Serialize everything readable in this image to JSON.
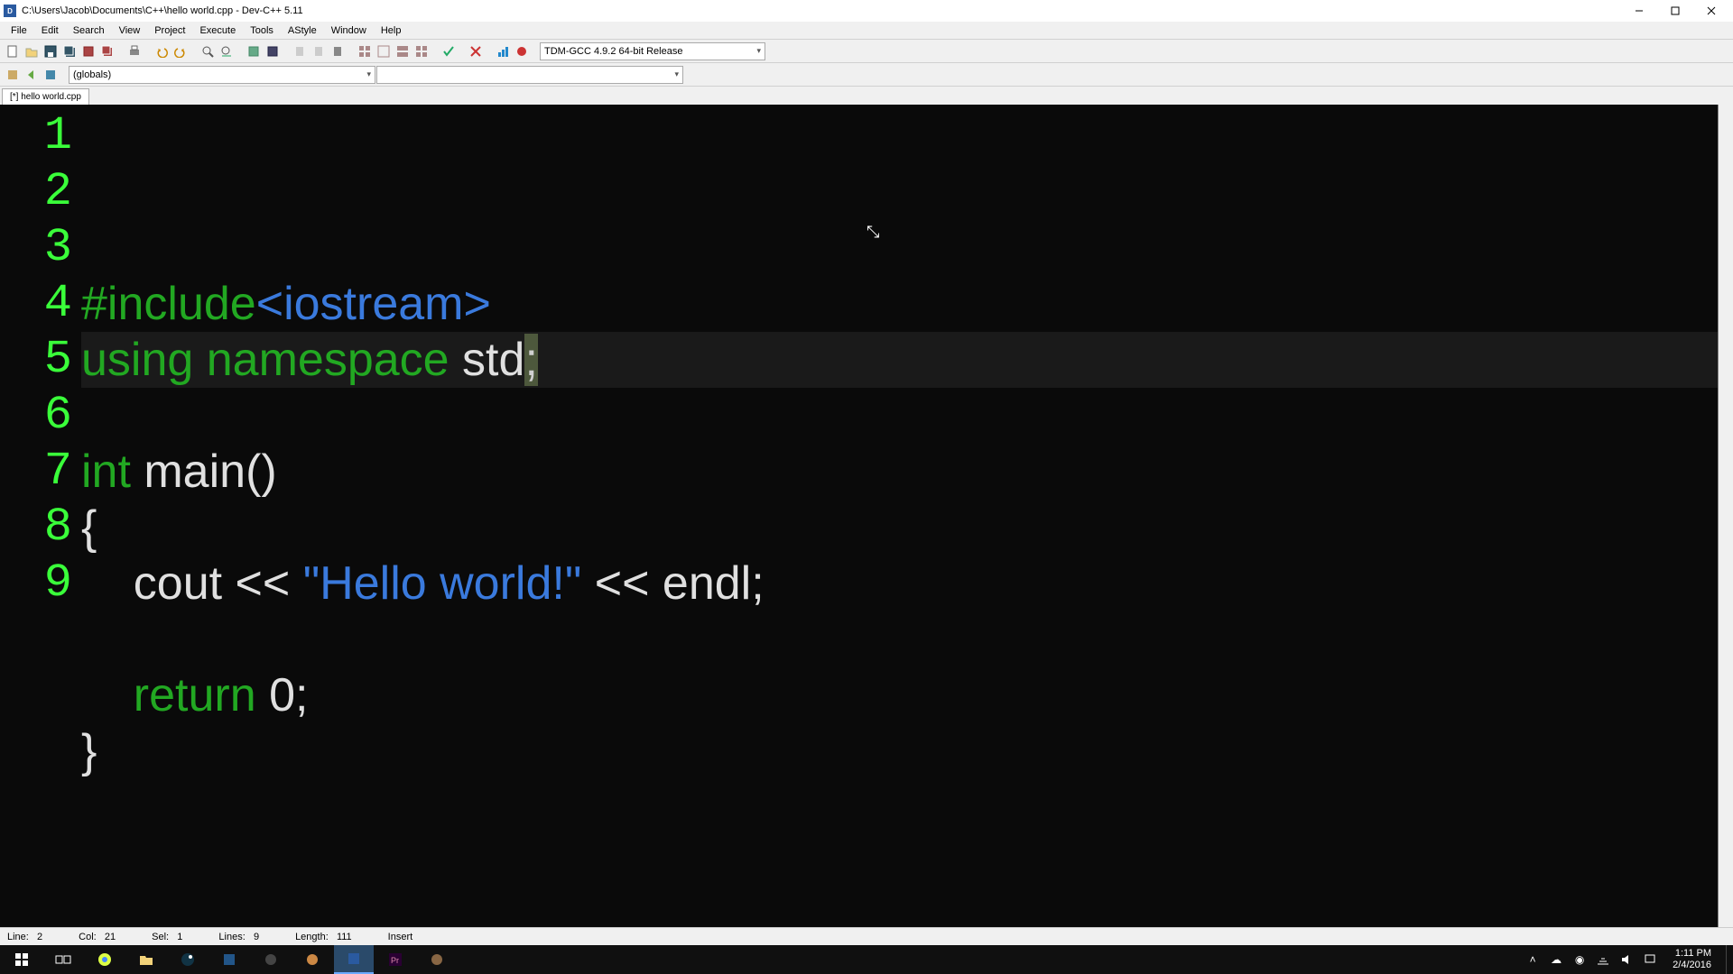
{
  "window": {
    "title": "C:\\Users\\Jacob\\Documents\\C++\\hello world.cpp - Dev-C++ 5.11"
  },
  "menu": [
    "File",
    "Edit",
    "Search",
    "View",
    "Project",
    "Execute",
    "Tools",
    "AStyle",
    "Window",
    "Help"
  ],
  "toolbar": {
    "compiler_combo": "TDM-GCC 4.9.2 64-bit Release"
  },
  "toolbar2": {
    "scope_combo": "(globals)"
  },
  "tab": {
    "label": "[*] hello world.cpp"
  },
  "code": {
    "line_count": 9,
    "lines": [
      {
        "segments": [
          {
            "t": "#include",
            "c": "kw-pp"
          },
          {
            "t": "<iostream>",
            "c": "kw-str"
          }
        ]
      },
      {
        "current": true,
        "segments": [
          {
            "t": "using",
            "c": "kw-green"
          },
          {
            "t": " ",
            "c": "kw-white"
          },
          {
            "t": "namespace",
            "c": "kw-green"
          },
          {
            "t": " std",
            "c": "kw-white"
          },
          {
            "t": ";",
            "c": "kw-cursor"
          }
        ]
      },
      {
        "segments": []
      },
      {
        "segments": [
          {
            "t": "int",
            "c": "kw-green"
          },
          {
            "t": " main()",
            "c": "kw-white"
          }
        ]
      },
      {
        "segments": [
          {
            "t": "{",
            "c": "kw-white"
          }
        ]
      },
      {
        "segments": [
          {
            "t": "    cout << ",
            "c": "kw-white"
          },
          {
            "t": "\"Hello world!\"",
            "c": "kw-str"
          },
          {
            "t": " << endl;",
            "c": "kw-white"
          }
        ]
      },
      {
        "segments": []
      },
      {
        "segments": [
          {
            "t": "    ",
            "c": "kw-white"
          },
          {
            "t": "return",
            "c": "kw-green"
          },
          {
            "t": " 0;",
            "c": "kw-white"
          }
        ]
      },
      {
        "segments": [
          {
            "t": "}",
            "c": "kw-white"
          }
        ]
      }
    ]
  },
  "status": {
    "line_lbl": "Line:",
    "line": "2",
    "col_lbl": "Col:",
    "col": "21",
    "sel_lbl": "Sel:",
    "sel": "1",
    "lines_lbl": "Lines:",
    "lines": "9",
    "len_lbl": "Length:",
    "len": "111",
    "mode": "Insert"
  },
  "taskbar": {
    "time": "1:11 PM",
    "date": "2/4/2016"
  }
}
